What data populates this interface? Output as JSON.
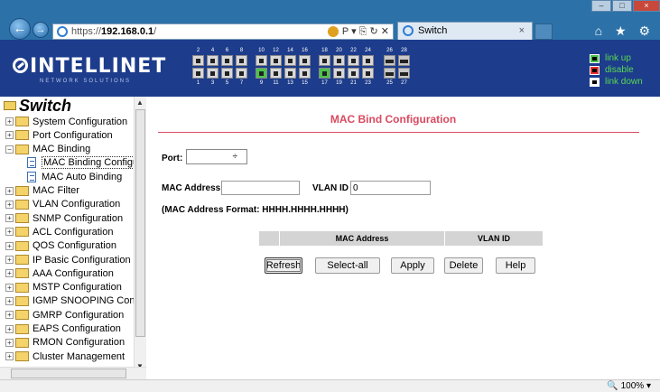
{
  "browser": {
    "url_prefix": "https://",
    "url_host": "192.168.0.1",
    "url_suffix": "/",
    "tab_title": "Switch",
    "tab_close": "×",
    "window_controls": [
      "–",
      "□",
      "×"
    ],
    "tool_icons": [
      "home-icon",
      "star-icon",
      "gear-icon"
    ],
    "tools_glyphs": "⌂ ★ ⚙",
    "addr_icon_glyphs": "P ▾ ⎘ ↻ ✕"
  },
  "header": {
    "logo_text": "INTELLINET",
    "logo_subtitle": "NETWORK SOLUTIONS",
    "port_top_numbers": [
      "2",
      "4",
      "6",
      "8",
      "10",
      "12",
      "14",
      "16",
      "18",
      "20",
      "22",
      "24",
      "26",
      "28"
    ],
    "port_bottom_numbers": [
      "1",
      "3",
      "5",
      "7",
      "9",
      "11",
      "13",
      "15",
      "17",
      "19",
      "21",
      "23",
      "25",
      "27"
    ],
    "ports_up": [
      9,
      17
    ],
    "legend": [
      {
        "label": "link up",
        "color": "#4cc34c"
      },
      {
        "label": "disable",
        "color": "#e83030"
      },
      {
        "label": "link down",
        "color": "#ffffff"
      }
    ]
  },
  "sidebar": {
    "title": "Switch",
    "items": [
      {
        "label": "System Configuration",
        "type": "folder",
        "expanded": false
      },
      {
        "label": "Port Configuration",
        "type": "folder",
        "expanded": false
      },
      {
        "label": "MAC Binding",
        "type": "folder",
        "expanded": true
      },
      {
        "label": "MAC Binding Configura",
        "type": "page",
        "selected": true
      },
      {
        "label": "MAC Auto Binding",
        "type": "page"
      },
      {
        "label": "MAC Filter",
        "type": "folder",
        "expanded": false
      },
      {
        "label": "VLAN Configuration",
        "type": "folder",
        "expanded": false
      },
      {
        "label": "SNMP Configuration",
        "type": "folder",
        "expanded": false
      },
      {
        "label": "ACL Configuration",
        "type": "folder",
        "expanded": false
      },
      {
        "label": "QOS Configuration",
        "type": "folder",
        "expanded": false
      },
      {
        "label": "IP Basic Configuration",
        "type": "folder",
        "expanded": false
      },
      {
        "label": "AAA Configuration",
        "type": "folder",
        "expanded": false
      },
      {
        "label": "MSTP Configuration",
        "type": "folder",
        "expanded": false
      },
      {
        "label": "IGMP SNOOPING Config",
        "type": "folder",
        "expanded": false
      },
      {
        "label": "GMRP Configuration",
        "type": "folder",
        "expanded": false
      },
      {
        "label": "EAPS Configuration",
        "type": "folder",
        "expanded": false
      },
      {
        "label": "RMON Configuration",
        "type": "folder",
        "expanded": false
      },
      {
        "label": "Cluster Management",
        "type": "folder",
        "expanded": false
      }
    ]
  },
  "main": {
    "title": "MAC Bind Configuration",
    "port_label": "Port:",
    "port_value": "",
    "port_arrow": "÷",
    "mac_label": "MAC Address",
    "mac_value": "",
    "vlan_label": "VLAN ID",
    "vlan_value": "0",
    "format_note": "(MAC Address Format: HHHH.HHHH.HHHH)",
    "table_headers": [
      "",
      "MAC Address",
      "VLAN ID"
    ],
    "buttons": {
      "refresh": "Refresh",
      "select_all": "Select-all",
      "apply": "Apply",
      "delete": "Delete",
      "help": "Help"
    }
  },
  "statusbar": {
    "zoom": "100%",
    "zoom_arrow": "▾"
  }
}
